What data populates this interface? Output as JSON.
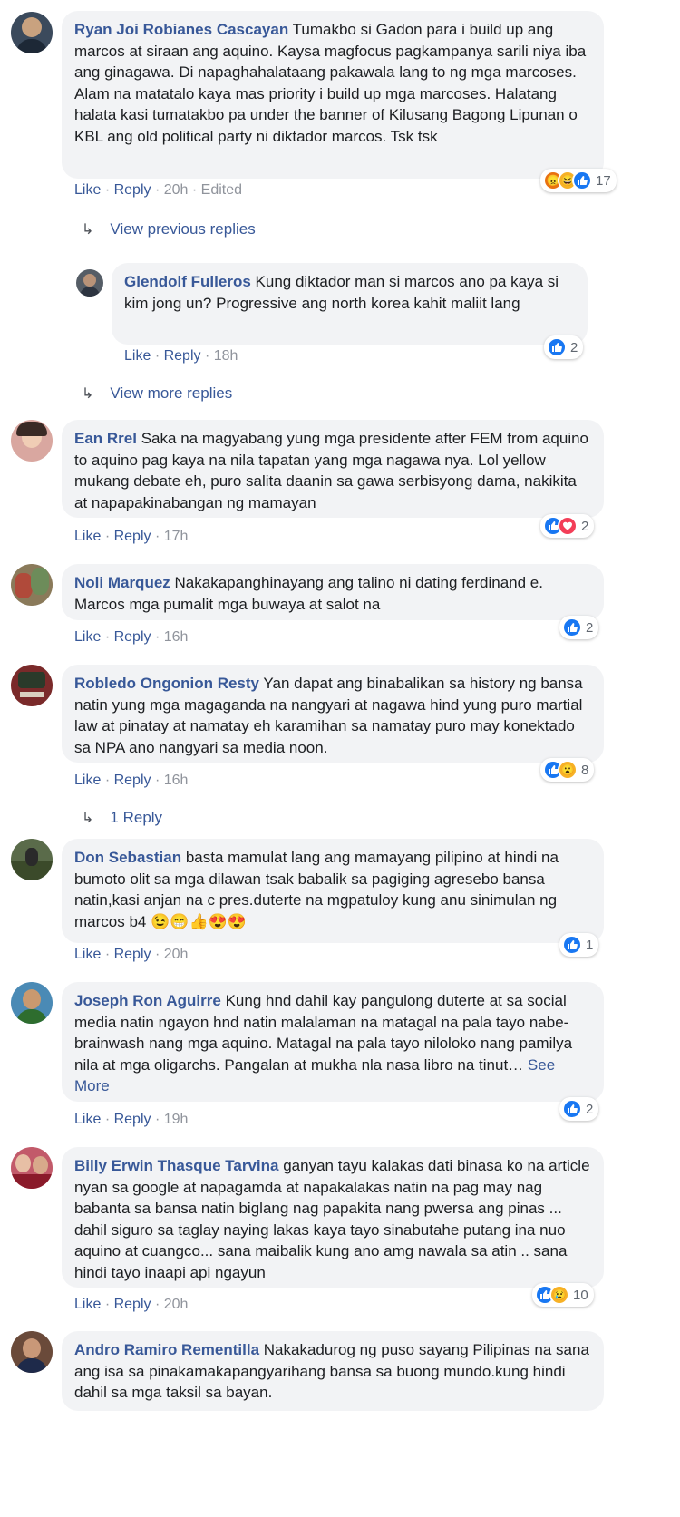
{
  "comments": [
    {
      "author": "Ryan Joi Robianes Cascayan",
      "text": "Tumakbo si Gadon para i build up ang marcos at siraan ang aquino. Kaysa magfocus pagkampanya sarili niya iba ang ginagawa. Di napaghahalataang pakawala lang to ng mga marcoses. Alam na matatalo kaya mas priority i build up mga marcoses. Halatang halata kasi tumatakbo pa under the banner of Kilusang Bagong Lipunan o KBL ang old political party ni diktador marcos. Tsk tsk",
      "like": "Like",
      "reply": "Reply",
      "time": "20h",
      "edited": "Edited",
      "reaction_count": "17",
      "avatar_color": "#3b4a5c"
    },
    {
      "author": "Glendolf Fulleros",
      "text": "Kung diktador man si marcos ano pa kaya si kim jong un? Progressive ang north korea kahit maliit lang",
      "like": "Like",
      "reply": "Reply",
      "time": "18h",
      "reaction_count": "2",
      "avatar_color": "#555d66"
    },
    {
      "author": "Ean Rrel",
      "text": "Saka na magyabang yung mga presidente after FEM from aquino to aquino pag kaya na nila tapatan yang mga nagawa nya. Lol yellow mukang debate eh, puro salita daanin sa gawa serbisyong dama, nakikita at napapakinabangan ng mamayan",
      "like": "Like",
      "reply": "Reply",
      "time": "17h",
      "reaction_count": "2",
      "avatar_color": "#d9a7a0"
    },
    {
      "author": "Noli Marquez",
      "text": "Nakakapanghinayang ang talino ni dating ferdinand e. Marcos mga pumalit mga buwaya at salot na",
      "like": "Like",
      "reply": "Reply",
      "time": "16h",
      "reaction_count": "2",
      "avatar_color": "#8a7a5a"
    },
    {
      "author": "Robledo Ongonion Resty",
      "text": "Yan dapat ang binabalikan sa history ng bansa natin yung mga magaganda na nangyari at nagawa hind yung puro martial law at pinatay at namatay eh karamihan sa namatay puro may konektado sa NPA ano nangyari sa media noon.",
      "like": "Like",
      "reply": "Reply",
      "time": "16h",
      "reaction_count": "8",
      "avatar_color": "#7a2a2a"
    },
    {
      "author": "Don Sebastian",
      "text": "basta mamulat lang ang mamayang pilipino at hindi na bumoto olit sa mga dilawan tsak babalik sa pagiging agresebo bansa natin,kasi anjan na c pres.duterte na mgpatuloy kung anu sinimulan ng marcos b4",
      "emojis": "😉😁👍😍😍",
      "like": "Like",
      "reply": "Reply",
      "time": "20h",
      "reaction_count": "1",
      "avatar_color": "#5a6b4a"
    },
    {
      "author": "Joseph Ron Aguirre",
      "text": "Kung hnd dahil kay pangulong duterte at sa social media natin ngayon hnd natin malalaman na matagal na pala tayo nabe-brainwash nang mga aquino. Matagal na pala tayo niloloko nang pamilya nila at mga oligarchs. Pangalan at mukha nla nasa libro na tinut…",
      "see_more": "See More",
      "like": "Like",
      "reply": "Reply",
      "time": "19h",
      "reaction_count": "2",
      "avatar_color": "#4a8ab5"
    },
    {
      "author": "Billy Erwin Thasque Tarvina",
      "text": "ganyan tayu kalakas dati binasa ko na article nyan sa google at napagamda at napakalakas natin na pag may nag babanta sa bansa natin biglang nag papakita nang pwersa ang pinas ... dahil siguro sa taglay naying lakas kaya tayo sinabutahe putang ina nuo aquino at cuangco... sana maibalik kung ano amg nawala sa atin .. sana hindi tayo inaapi api ngayun",
      "like": "Like",
      "reply": "Reply",
      "time": "20h",
      "reaction_count": "10",
      "avatar_color": "#c25a6a"
    },
    {
      "author": "Andro Ramiro Rementilla",
      "text": "Nakakadurog ng puso sayang Pilipinas na sana ang isa sa pinakamakapangyarihang bansa sa buong mundo.kung hindi dahil sa mga taksil sa bayan.",
      "avatar_color": "#6a4a3a"
    }
  ],
  "links": {
    "view_previous": "View previous replies",
    "view_more": "View more replies",
    "one_reply": "1 Reply"
  },
  "separator": "·",
  "icons": {
    "reply_arrow": "reply-arrow-icon"
  },
  "colors": {
    "link": "#385898",
    "bubble": "#f2f3f5",
    "like": "#1877f2"
  }
}
